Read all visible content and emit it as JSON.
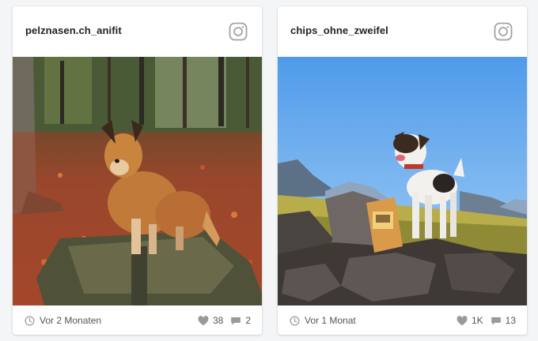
{
  "posts": [
    {
      "username": "pelznasen.ch_anifit",
      "time": "Vor 2 Monaten",
      "likes": "38",
      "comments": "2"
    },
    {
      "username": "chips_ohne_zweifel",
      "time": "Vor 1 Monat",
      "likes": "1K",
      "comments": "13"
    }
  ],
  "icons": {
    "platform": "instagram-icon",
    "time": "clock-icon",
    "likes": "heart-icon",
    "comments": "comment-icon"
  },
  "colors": {
    "text": "#222222",
    "meta": "#555555",
    "icon": "#9a9a9a"
  }
}
